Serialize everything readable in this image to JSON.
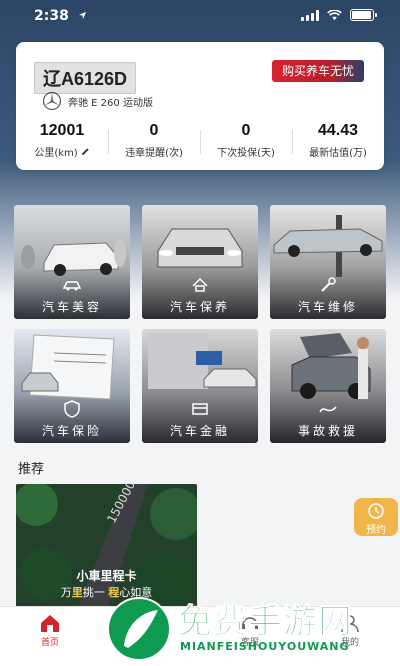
{
  "status_bar": {
    "time": "2:38",
    "icons": [
      "location-arrow-icon",
      "signal-icon",
      "wifi-icon",
      "battery-icon"
    ],
    "battery_level": 0.95
  },
  "vehicle": {
    "plate": "辽A6126D",
    "model": "奔驰 E 260 运动版",
    "brand_icon": "mercedes-benz-logo",
    "buy_button": "购买养车无忧",
    "stats": [
      {
        "value": "12001",
        "label": "公里(km)",
        "editable": true
      },
      {
        "value": "0",
        "label": "违章提醒(次)"
      },
      {
        "value": "0",
        "label": "下次投保(天)"
      },
      {
        "value": "44.43",
        "label": "最新估值(万)"
      }
    ]
  },
  "services": [
    {
      "label": "汽车美容",
      "icon": "car-wash-icon"
    },
    {
      "label": "汽车保养",
      "icon": "car-care-icon"
    },
    {
      "label": "汽车维修",
      "icon": "repair-icon"
    },
    {
      "label": "汽车保险",
      "icon": "insurance-icon"
    },
    {
      "label": "汽车金融",
      "icon": "finance-icon"
    },
    {
      "label": "事故救援",
      "icon": "rescue-icon"
    }
  ],
  "recommend": {
    "title": "推荐",
    "banner": {
      "title": "小車里程卡",
      "subtitle_parts": [
        "万",
        "里",
        "挑一",
        "程",
        "心如意"
      ],
      "road_number": "150000"
    }
  },
  "reserve_button": "预约",
  "tab_bar": [
    {
      "label": "首页",
      "icon": "home-icon",
      "active": true
    },
    {
      "label": "",
      "icon": "car-icon"
    },
    {
      "label": "客服",
      "icon": "customer-service-icon"
    },
    {
      "label": "我的",
      "icon": "user-icon"
    }
  ],
  "watermark": {
    "title": "免费手游网",
    "subtitle": "MIANFEISHOUYOUWANG"
  },
  "colors": {
    "header": "#2c4566",
    "accent_red": "#d4252f",
    "reserve_orange": "#f0b64a",
    "watermark_green": "#0f9a52"
  }
}
